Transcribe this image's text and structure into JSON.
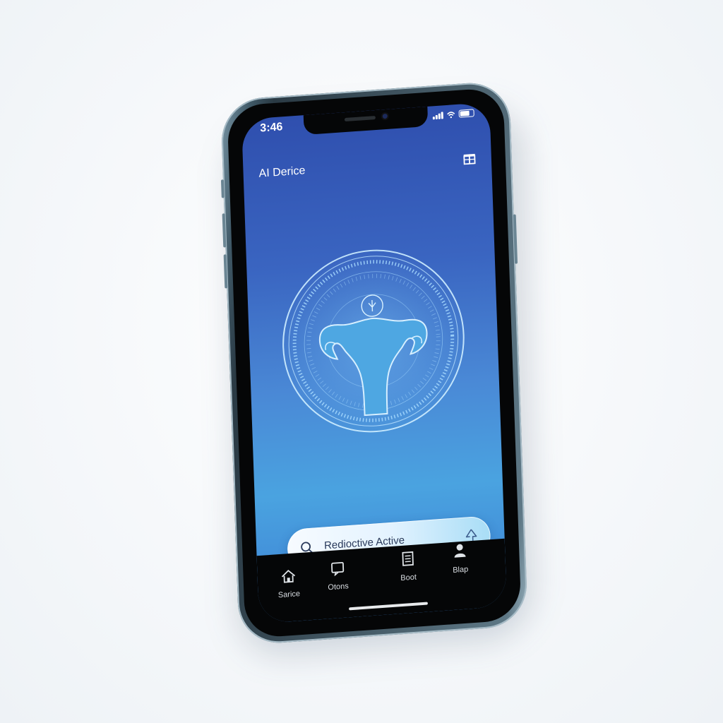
{
  "status_bar": {
    "time": "3:46"
  },
  "header": {
    "title": "AI Derice",
    "action_icon": "gift-icon"
  },
  "hero": {
    "icon": "uterus-hologram-icon",
    "badge_icon": "figure-icon"
  },
  "search": {
    "icon": "search-icon",
    "placeholder": "Redioctive Active",
    "trailing_icon": "mic-icon"
  },
  "tabbar": {
    "tabs": [
      {
        "label": "Sarice",
        "icon": "home-icon"
      },
      {
        "label": "Otons",
        "icon": "message-icon"
      },
      {
        "label": "Boot",
        "icon": "book-icon"
      },
      {
        "label": "Blap",
        "icon": "profile-icon"
      }
    ]
  },
  "colors": {
    "screen_top": "#2f4fae",
    "screen_bottom": "#4aa3e0",
    "accent": "#8fd3ff",
    "frame": "#3f5866"
  }
}
